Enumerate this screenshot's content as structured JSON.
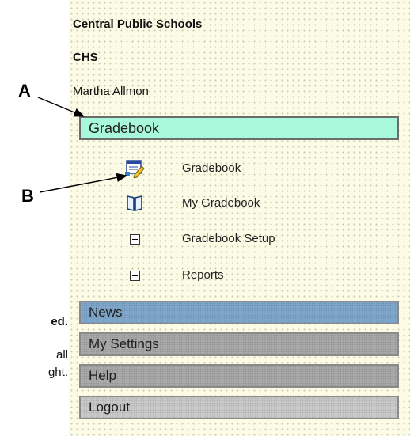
{
  "header": {
    "organization": "Central Public Schools",
    "school": "CHS",
    "user": "Martha Allmon"
  },
  "sections": {
    "gradebook": "Gradebook",
    "news": "News",
    "my_settings": "My Settings",
    "help": "Help",
    "logout": "Logout"
  },
  "gradebook_menu": [
    {
      "label": "Gradebook",
      "icon": "gradebook-app-icon"
    },
    {
      "label": "My Gradebook",
      "icon": "open-book-icon"
    },
    {
      "label": "Gradebook Setup",
      "icon": "expand-plus-icon"
    },
    {
      "label": "Reports",
      "icon": "expand-plus-icon"
    }
  ],
  "callouts": {
    "a": "A",
    "b": "B"
  },
  "clipped_text": {
    "line1": "ed.",
    "line2": "all",
    "line3": "ght."
  },
  "colors": {
    "panel_bg": "#fbfbe6",
    "gradebook_bar": "#a8f9da",
    "news_bar": "#7fa7cc",
    "gray_bar": "#a9a9a9"
  }
}
